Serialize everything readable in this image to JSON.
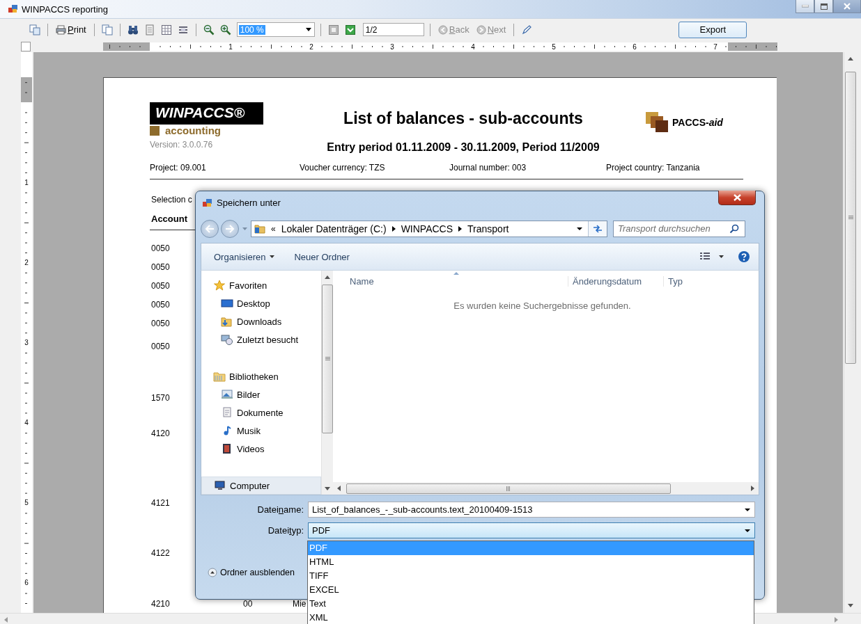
{
  "window": {
    "title": "WINPACCS reporting"
  },
  "toolbar": {
    "print": {
      "mnemonic": "P",
      "rest": "rint"
    },
    "zoom": {
      "value": "100 %"
    },
    "page_field": {
      "value": "1/2"
    },
    "back": {
      "mnemonic": "B",
      "rest": "ack",
      "disabled": true
    },
    "next": {
      "mnemonic": "N",
      "rest": "ext",
      "disabled": true
    },
    "export": {
      "label": "Export"
    }
  },
  "ruler": {
    "horizontal": [
      "1",
      "2",
      "3",
      "4",
      "5",
      "6",
      "7"
    ],
    "vertical": [
      "1",
      "2",
      "3",
      "4",
      "5",
      "6"
    ]
  },
  "report": {
    "logo": {
      "wordmark": "WINPACCS®",
      "tagline": "accounting"
    },
    "version": "Version: 3.0.0.76",
    "title": "List of balances - sub-accounts",
    "subtitle": "Entry period 01.11.2009 - 30.11.2009, Period 11/2009",
    "partner_logo": "PACCS-*aid*",
    "info": [
      "Project: 09.001",
      "Voucher currency: TZS",
      "Journal number: 003",
      "Project country: Tanzania"
    ],
    "selection": "Selection c",
    "header": "Account",
    "rows": [
      {
        "account": "0050"
      },
      {
        "account": "0050"
      },
      {
        "account": "0050"
      },
      {
        "account": "0050"
      },
      {
        "account": "0050"
      },
      {
        "account": "0050"
      },
      {
        "account": "1570"
      },
      {
        "account": "4120"
      },
      {
        "account": "4121"
      },
      {
        "account": "4122"
      },
      {
        "account": "4210",
        "column_2": "00",
        "column_3": "Mie"
      }
    ]
  },
  "dialog": {
    "title": "Speichern unter",
    "overflow": "«",
    "breadcrumbs": [
      "Lokaler Datenträger (C:)",
      "WINPACCS",
      "Transport"
    ],
    "search": {
      "placeholder": "Transport durchsuchen"
    },
    "commands": [
      {
        "label": "Organisieren",
        "kind": "menu"
      },
      {
        "label": "Neuer Ordner",
        "kind": "button"
      }
    ],
    "nav": [
      {
        "label": "Favoriten",
        "kind": "favorites",
        "selected": false,
        "children": [
          {
            "label": "Desktop",
            "kind": "desktop",
            "selected": false
          },
          {
            "label": "Downloads",
            "kind": "downloads",
            "selected": false
          },
          {
            "label": "Zuletzt besucht",
            "kind": "recent",
            "selected": false
          }
        ]
      },
      {
        "label": "Bibliotheken",
        "kind": "library",
        "selected": false,
        "children": [
          {
            "label": "Bilder",
            "kind": "pictures",
            "selected": false
          },
          {
            "label": "Dokumente",
            "kind": "documents",
            "selected": false
          },
          {
            "label": "Musik",
            "kind": "music",
            "selected": false
          },
          {
            "label": "Videos",
            "kind": "videos",
            "selected": false
          }
        ]
      },
      {
        "label": "Computer",
        "kind": "computer",
        "selected": true
      }
    ],
    "columns": [
      "Name",
      "Änderungsdatum",
      "Typ"
    ],
    "empty_message": "Es wurden keine Suchergebnisse gefunden.",
    "filename": {
      "label_parts": [
        "Datei",
        "n",
        "ame:"
      ],
      "value": "List_of_balances_-_sub-accounts.text_20100409-1513"
    },
    "filetype": {
      "label_parts": [
        "Datei",
        "t",
        "yp:"
      ],
      "value": "PDF",
      "expanded": true,
      "options": [
        {
          "label": "PDF",
          "selected": true
        },
        {
          "label": "HTML",
          "selected": false
        },
        {
          "label": "TIFF",
          "selected": false
        },
        {
          "label": "EXCEL",
          "selected": false
        },
        {
          "label": "Text",
          "selected": false
        },
        {
          "label": "XML",
          "selected": false
        }
      ]
    },
    "hide_folders": "Ordner ausblenden"
  }
}
